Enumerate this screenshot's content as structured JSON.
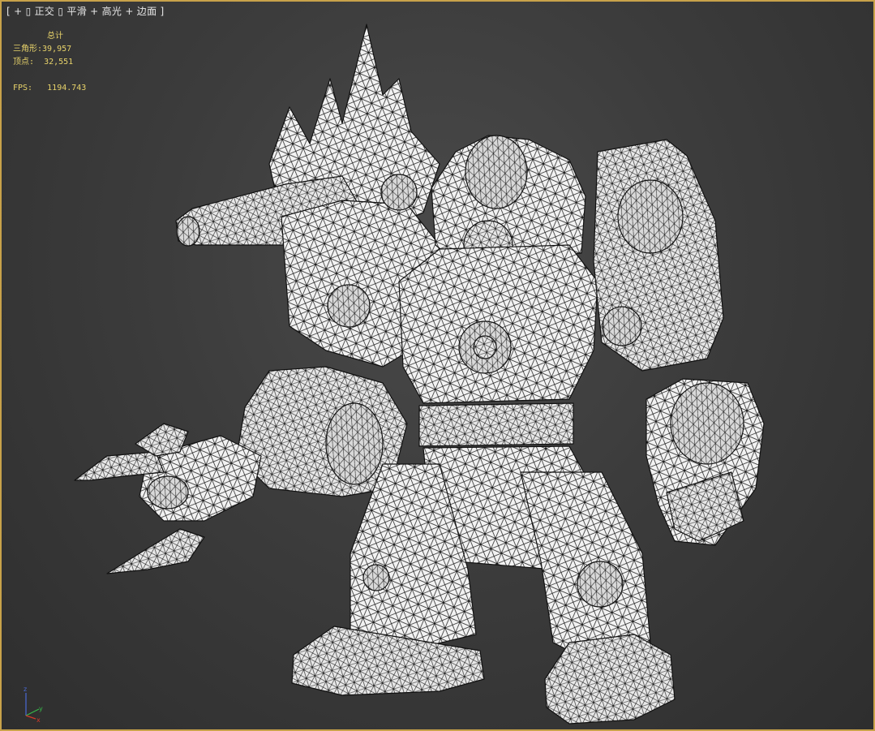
{
  "viewport": {
    "label_bracket_open": "[",
    "label_plus_1": "+",
    "label_view": "正交",
    "label_shading": "平滑 + 高光",
    "label_edges": "边面",
    "label_plus_2": "+",
    "label_bracket_close": "]"
  },
  "stats": {
    "header": "总计",
    "triangles_label": "三角形:",
    "triangles_value": "39,957",
    "vertices_label": "顶点:",
    "vertices_value": "32,551",
    "fps_label": "FPS:",
    "fps_value": "1194.743"
  },
  "axis": {
    "z": "z",
    "y": "y",
    "x": "x",
    "x_color": "#d23a2a",
    "y_color": "#38b84a",
    "z_color": "#4a6ad8"
  },
  "colors": {
    "frame_highlight": "#c8a24a",
    "stats_text": "#e8d36a",
    "mesh_fill": "#f2f2f2",
    "mesh_edge": "#111111"
  }
}
